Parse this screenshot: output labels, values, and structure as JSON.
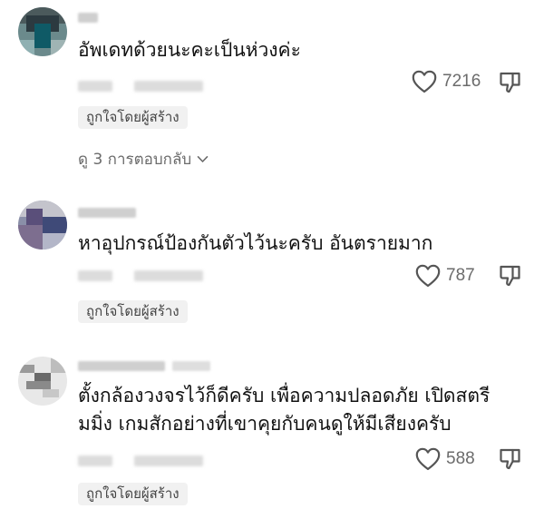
{
  "comments": [
    {
      "text": "อัพเดทด้วยนะคะเป็นห่วงค่ะ",
      "likes": "7216",
      "badge": "ถูกใจโดยผู้สร้าง",
      "replies": "ดู 3 การตอบกลับ"
    },
    {
      "text": "หาอุปกรณ์ป้องกันตัวไว้นะครับ อันตรายมาก",
      "likes": "787",
      "badge": "ถูกใจโดยผู้สร้าง"
    },
    {
      "text": "ตั้งกล้องวงจรไว้ก็ดีครับ เพื่อความปลอดภัย เปิดสตรี\nมมิ่ง เกมสักอย่างที่เขาคุยกับคนดูให้มีเสียงครับ",
      "likes": "588",
      "badge": "ถูกใจโดยผู้สร้าง"
    }
  ],
  "icons": {
    "like": "heart-outline-icon",
    "dislike": "thumbs-down-outline-icon",
    "expand": "chevron-down-icon"
  },
  "colors": {
    "text": "#111111",
    "muted": "#6b6b6b",
    "badge_bg": "#f1f1f1"
  }
}
